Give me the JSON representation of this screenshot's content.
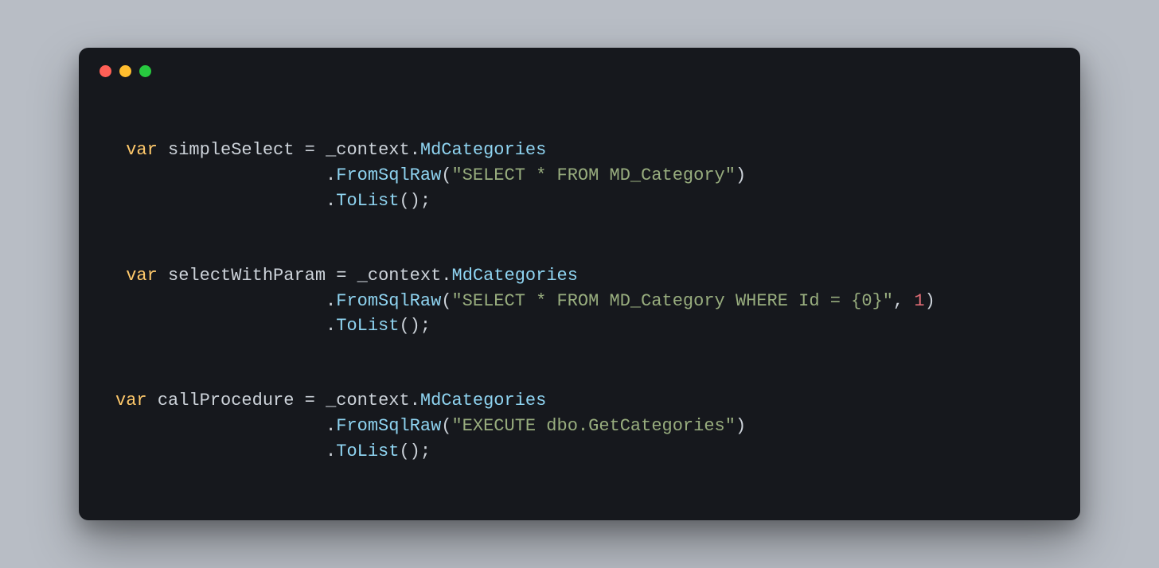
{
  "code": {
    "blocks": [
      {
        "indent1": " ",
        "var": "var",
        "name": "simpleSelect",
        "eq": " = ",
        "ctx": "_context",
        "dot1": ".",
        "prop": "MdCategories",
        "indent2": "                    ",
        "dot2": ".",
        "m1": "FromSqlRaw",
        "p1o": "(",
        "str": "\"SELECT * FROM MD_Category\"",
        "p1c": ")",
        "indent3": "                    ",
        "dot3": ".",
        "m2": "ToList",
        "p2": "();"
      },
      {
        "indent1": " ",
        "var": "var",
        "name": "selectWithParam",
        "eq": " = ",
        "ctx": "_context",
        "dot1": ".",
        "prop": "MdCategories",
        "indent2": "                    ",
        "dot2": ".",
        "m1": "FromSqlRaw",
        "p1o": "(",
        "str": "\"SELECT * FROM MD_Category WHERE Id = {0}\"",
        "comma": ", ",
        "num": "1",
        "p1c": ")",
        "indent3": "                    ",
        "dot3": ".",
        "m2": "ToList",
        "p2": "();"
      },
      {
        "indent1": "",
        "var": "var",
        "name": "callProcedure",
        "eq": " = ",
        "ctx": "_context",
        "dot1": ".",
        "prop": "MdCategories",
        "indent2": "                    ",
        "dot2": ".",
        "m1": "FromSqlRaw",
        "p1o": "(",
        "str": "\"EXECUTE dbo.GetCategories\"",
        "p1c": ")",
        "indent3": "                    ",
        "dot3": ".",
        "m2": "ToList",
        "p2": "();"
      }
    ]
  }
}
